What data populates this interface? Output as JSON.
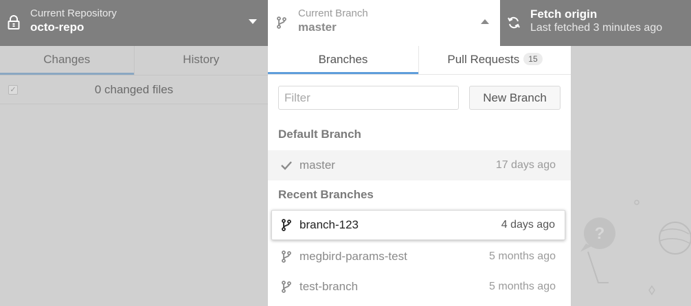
{
  "toolbar": {
    "repository": {
      "label": "Current Repository",
      "value": "octo-repo",
      "icon": "lock-icon"
    },
    "branch": {
      "label": "Current Branch",
      "value": "master",
      "icon": "git-branch-icon"
    },
    "fetch": {
      "label": "Fetch origin",
      "sub": "Last fetched 3 minutes ago",
      "icon": "sync-icon"
    }
  },
  "left_pane": {
    "tabs": [
      {
        "label": "Changes",
        "active": true
      },
      {
        "label": "History",
        "active": false
      }
    ],
    "changes_summary": "0 changed files"
  },
  "branch_dropdown": {
    "tabs": [
      {
        "label": "Branches",
        "active": true
      },
      {
        "label": "Pull Requests",
        "badge": "15"
      }
    ],
    "filter_placeholder": "Filter",
    "new_branch_label": "New Branch",
    "default_header": "Default Branch",
    "default_branch": {
      "name": "master",
      "time": "17 days ago",
      "icon": "check-icon"
    },
    "recent_header": "Recent Branches",
    "recent_branches": [
      {
        "name": "branch-123",
        "time": "4 days ago",
        "icon": "git-branch-icon",
        "selected": true
      },
      {
        "name": "megbird-params-test",
        "time": "5 months ago",
        "icon": "git-branch-icon"
      },
      {
        "name": "test-branch",
        "time": "5 months ago",
        "icon": "git-branch-icon"
      }
    ]
  },
  "colors": {
    "toolbar_dark": "#7f7f7f",
    "active_tab_underline": "#5e9ddb",
    "overlay_bg": "#d0d0d0"
  }
}
